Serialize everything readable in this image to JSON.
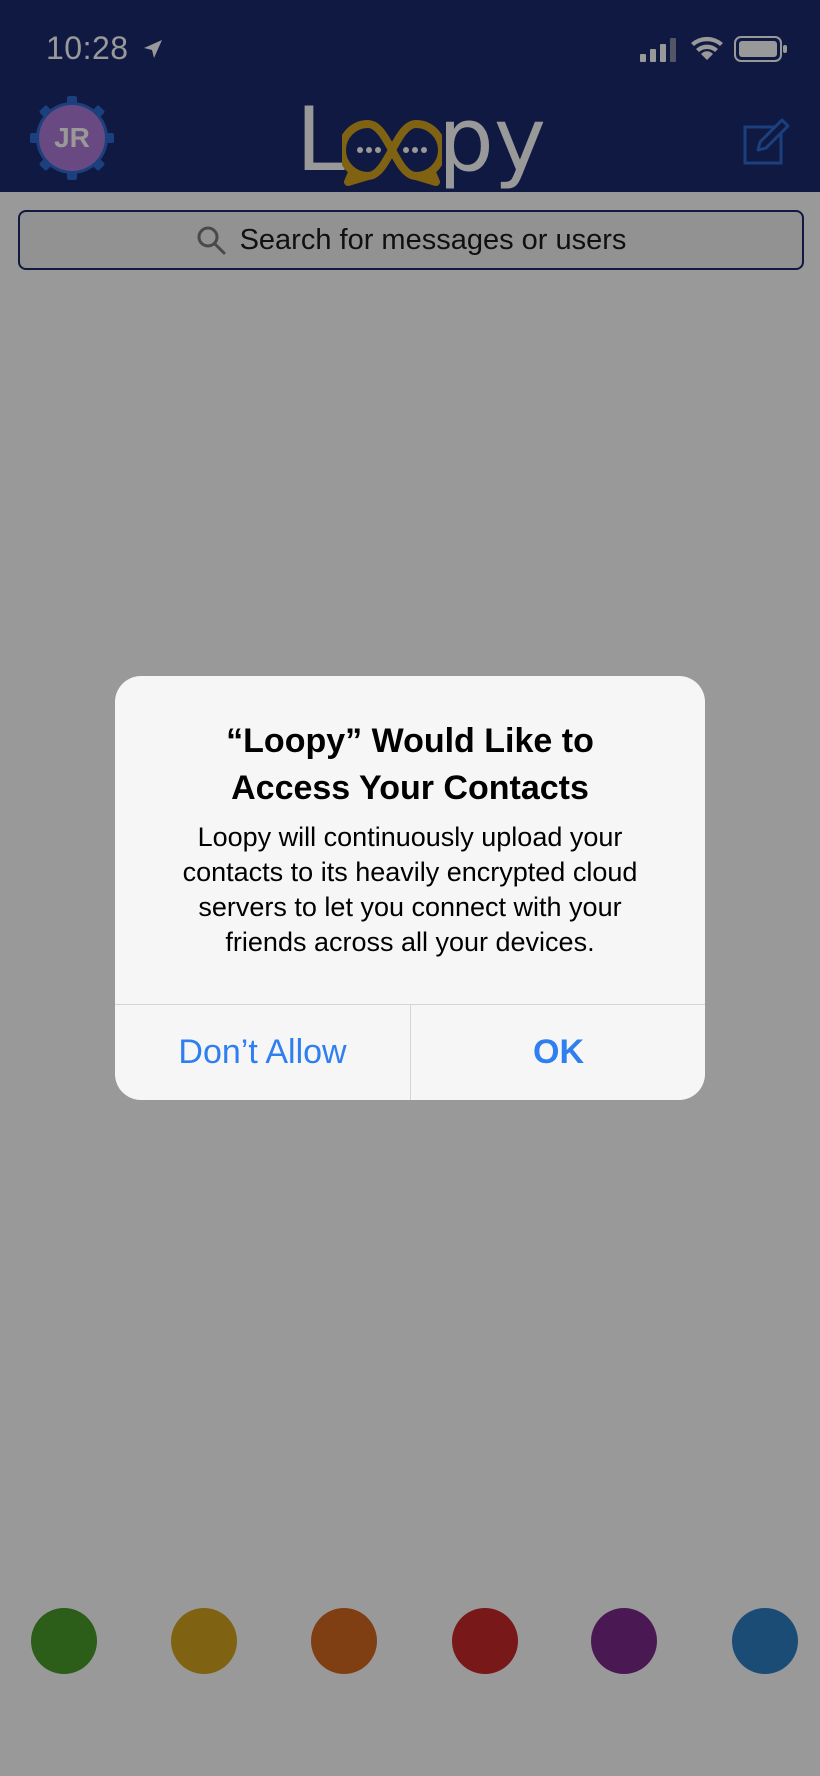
{
  "status_bar": {
    "time": "10:28"
  },
  "header": {
    "avatar_initials": "JR",
    "logo_text_left": "L",
    "logo_text_right": "py"
  },
  "search": {
    "placeholder": "Search for messages or users"
  },
  "color_dots": [
    "#4a9c2b",
    "#d6a421",
    "#d56a1e",
    "#c8282a",
    "#7c2b8a",
    "#2d7fc4"
  ],
  "alert": {
    "title_line1": "“Loopy” Would Like to",
    "title_line2": "Access Your Contacts",
    "message_line1": "Loopy will continuously upload your",
    "message_line2": "contacts to its heavily encrypted cloud",
    "message_line3": "servers to let you connect with your",
    "message_line4": "friends across all your devices.",
    "deny_label": "Don’t Allow",
    "ok_label": "OK"
  },
  "colors": {
    "nav_bg": "#1a2a6e",
    "alert_button": "#2f7ff0",
    "logo_accent": "#d6a421"
  }
}
